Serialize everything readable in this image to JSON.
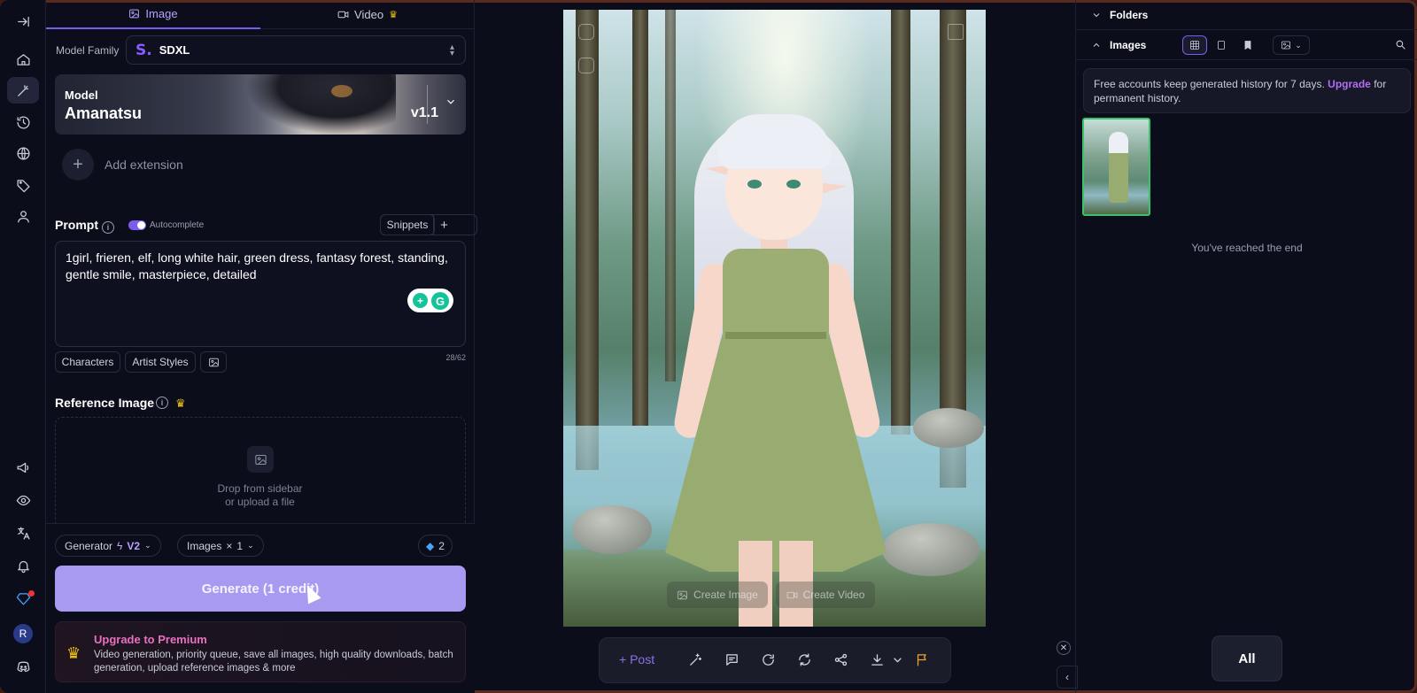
{
  "tabs": [
    {
      "label": "Image",
      "icon": "image-icon",
      "active": true
    },
    {
      "label": "Video",
      "icon": "video-icon",
      "premium": true
    }
  ],
  "model_family": {
    "label": "Model Family",
    "value": "SDXL",
    "logo": "S."
  },
  "model": {
    "label": "Model",
    "name": "Amanatsu",
    "version": "v1.1"
  },
  "extension": {
    "label": "Add extension"
  },
  "prompt": {
    "title": "Prompt",
    "autocomplete_label": "Autocomplete",
    "autocomplete_on": true,
    "snippets_label": "Snippets",
    "text": "1girl, frieren, elf, long white hair, green dress, fantasy forest, standing, gentle smile, masterpiece, detailed",
    "counter": "28/62"
  },
  "prompt_chips": [
    "Characters",
    "Artist Styles"
  ],
  "reference": {
    "title": "Reference Image",
    "drop_line1": "Drop from sidebar",
    "drop_line2": "or upload a file"
  },
  "settings": {
    "generator_label": "Generator",
    "generator_value": "V2",
    "images_label": "Images",
    "images_value": "1",
    "images_multiplier": "×",
    "gems": "2"
  },
  "generate": {
    "label": "Generate (1 credit)"
  },
  "upsell": {
    "title": "Upgrade to Premium",
    "body": "Video generation, priority queue, save all images, high quality downloads, batch generation, upload reference images & more"
  },
  "canvas": {
    "create_image": "Create Image",
    "create_video": "Create Video"
  },
  "toolbar": {
    "post": "+ Post"
  },
  "right": {
    "folders": "Folders",
    "images": "Images",
    "notice_pre": "Free accounts keep generated history for 7 days.",
    "notice_link": "Upgrade",
    "notice_post": "for permanent history.",
    "end": "You've reached the end",
    "filter_all": "All"
  },
  "user": {
    "initial": "R"
  },
  "colors": {
    "accent": "#7c5cf0",
    "generate_bg": "#a89af0",
    "upsell": "#e870c0",
    "crown": "#f5c518",
    "selected_thumb": "#39c36a"
  }
}
